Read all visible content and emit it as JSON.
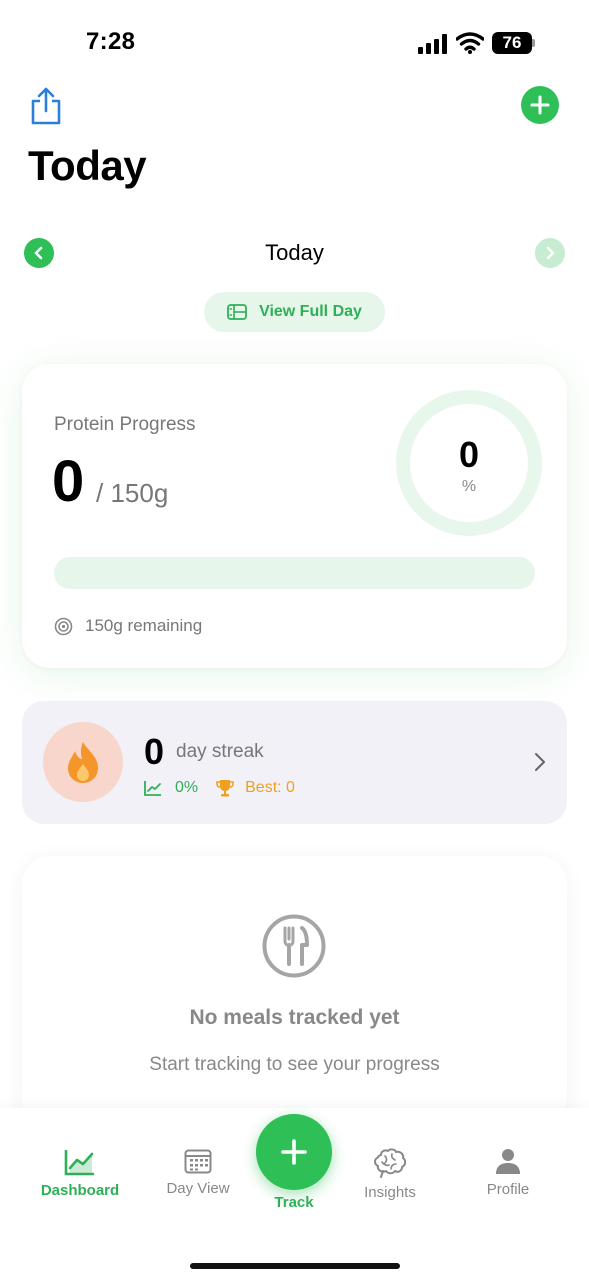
{
  "status_bar": {
    "time": "7:28",
    "battery": "76"
  },
  "header": {
    "title": "Today"
  },
  "day_nav": {
    "label": "Today",
    "view_full_day_label": "View Full Day"
  },
  "protein": {
    "label": "Protein Progress",
    "value": "0",
    "goal": "/ 150g",
    "percent_value": "0",
    "percent_unit": "%",
    "progress_fraction": 0,
    "remaining": "150g remaining"
  },
  "streak": {
    "value": "0",
    "label": "day streak",
    "trend": "0%",
    "best": "Best: 0"
  },
  "empty_state": {
    "title": "No meals tracked yet",
    "subtitle": "Start tracking to see your progress"
  },
  "tabs": [
    {
      "label": "Dashboard",
      "icon": "chart-line-icon",
      "active": true
    },
    {
      "label": "Day View",
      "icon": "calendar-icon",
      "active": false
    },
    {
      "label": "Track",
      "icon": "plus-icon",
      "active": false
    },
    {
      "label": "Insights",
      "icon": "brain-icon",
      "active": false
    },
    {
      "label": "Profile",
      "icon": "person-icon",
      "active": false
    }
  ],
  "colors": {
    "accent": "#2fbf57",
    "accent_light": "#e6f6ea",
    "streak_orange": "#f5962a",
    "muted_text": "#777777"
  }
}
